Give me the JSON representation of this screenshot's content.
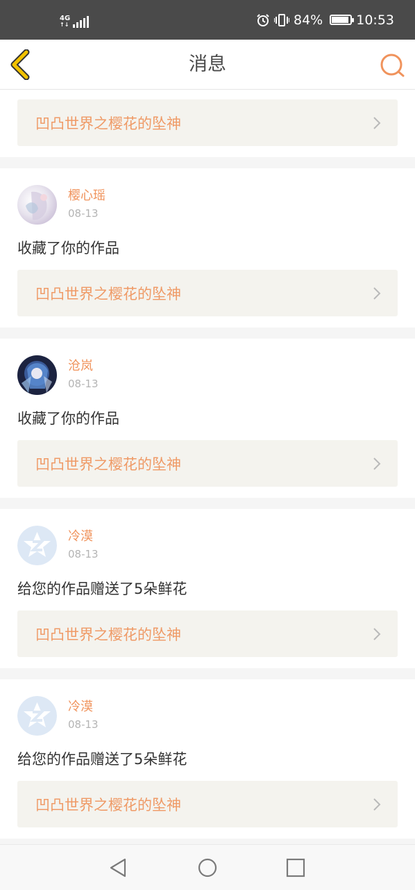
{
  "status_bar": {
    "network": "4G",
    "battery_percent": "84%",
    "battery_level": 0.84,
    "time": "10:53",
    "icons": [
      "signal-icon",
      "alarm-icon",
      "vibrate-icon",
      "battery-icon"
    ]
  },
  "nav": {
    "title": "消息",
    "back_icon": "back-chevron-icon",
    "search_icon": "search-icon"
  },
  "colors": {
    "accent_orange": "#f0935c",
    "back_yellow": "#f2c200",
    "link_bg": "#f4f3ee"
  },
  "first_card": {
    "work_title": "凹凸世界之樱花的坠神"
  },
  "messages": [
    {
      "username": "樱心瑶",
      "date": "08-13",
      "action": "收藏了你的作品",
      "work_title": "凹凸世界之樱花的坠神",
      "avatar": "anime-avatar-light"
    },
    {
      "username": "沧岚",
      "date": "08-13",
      "action": "收藏了你的作品",
      "work_title": "凹凸世界之樱花的坠神",
      "avatar": "anime-avatar-dark"
    },
    {
      "username": "冷漠",
      "date": "08-13",
      "action": "给您的作品赠送了5朵鲜花",
      "work_title": "凹凸世界之樱花的坠神",
      "avatar": "default-avatar-icon"
    },
    {
      "username": "冷漠",
      "date": "08-13",
      "action": "给您的作品赠送了5朵鲜花",
      "work_title": "凹凸世界之樱花的坠神",
      "avatar": "default-avatar-icon"
    }
  ],
  "system_nav": {
    "icons": [
      "back-triangle-icon",
      "home-circle-icon",
      "recents-square-icon"
    ]
  }
}
